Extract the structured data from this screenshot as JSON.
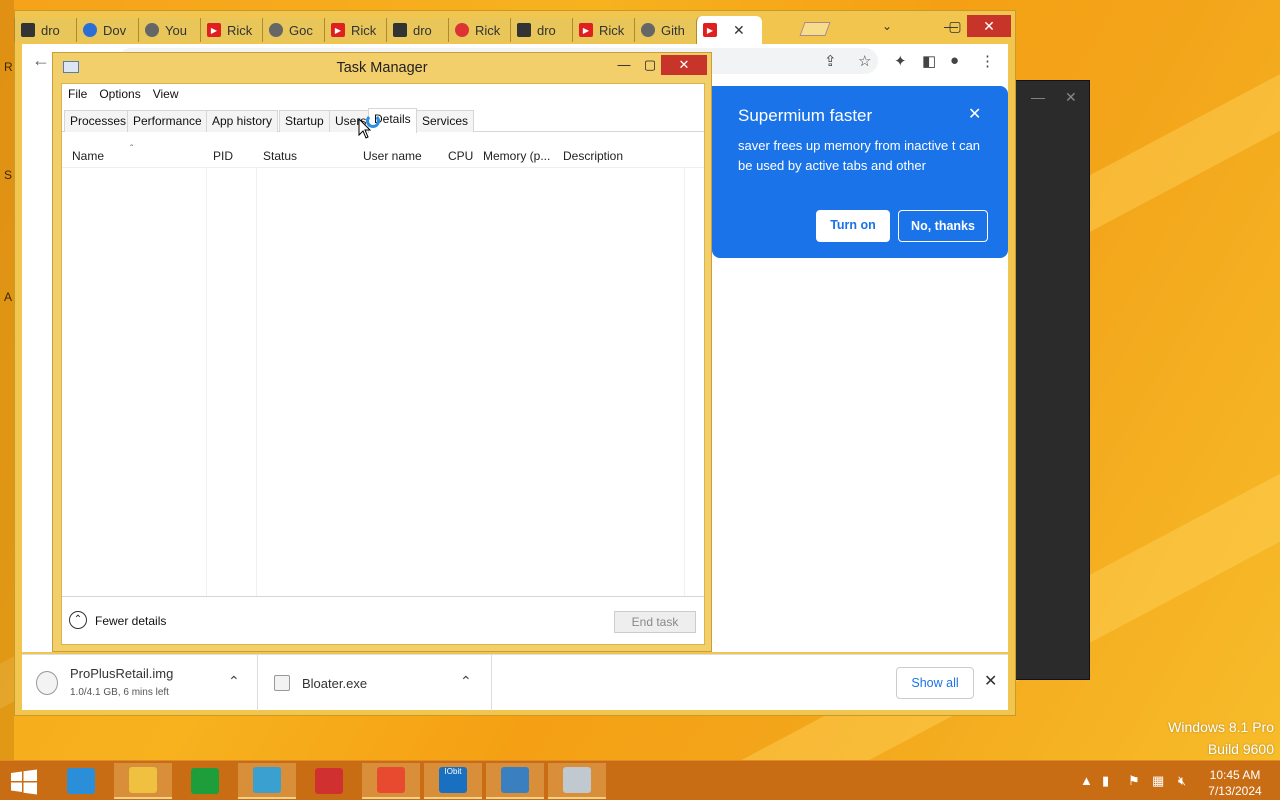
{
  "desktop": {
    "edge_letters": [
      "R",
      "S",
      "A"
    ],
    "os_name": "Windows 8.1 Pro",
    "build": "Build 9600"
  },
  "browser": {
    "tabs": [
      {
        "label": "dro",
        "icon": "terminal-icon"
      },
      {
        "label": "Dov",
        "icon": "power-icon"
      },
      {
        "label": "You",
        "icon": "supermium-icon"
      },
      {
        "label": "Rick",
        "icon": "youtube-icon"
      },
      {
        "label": "Goc",
        "icon": "supermium-icon"
      },
      {
        "label": "Rick",
        "icon": "youtube-icon"
      },
      {
        "label": "dro",
        "icon": "terminal-icon"
      },
      {
        "label": "Rick",
        "icon": "opera-icon"
      },
      {
        "label": "dro",
        "icon": "terminal-icon"
      },
      {
        "label": "Rick",
        "icon": "youtube-icon"
      },
      {
        "label": "Gith",
        "icon": "github-icon"
      },
      {
        "label": "",
        "icon": "youtube-icon",
        "active": true
      }
    ],
    "tab_close": "✕",
    "win_min": "—",
    "win_max": "▢",
    "win_close": "✕",
    "tab_search": "⌄",
    "memory_saver": {
      "title": "Supermium faster",
      "body": "saver frees up memory from inactive t can be used by active tabs and other",
      "close": "✕",
      "turn_on": "Turn on",
      "no_thanks": "No, thanks",
      "color": "#1a73e8"
    },
    "downloads": [
      {
        "name": "ProPlusRetail.img",
        "status": "1.0/4.1 GB, 6 mins left"
      },
      {
        "name": "Bloater.exe",
        "status": ""
      }
    ],
    "show_all": "Show all",
    "shelf_close": "✕"
  },
  "taskmgr": {
    "title": "Task Manager",
    "menu": [
      "File",
      "Options",
      "View"
    ],
    "tabs": [
      "Processes",
      "Performance",
      "App history",
      "Startup",
      "Users",
      "Details",
      "Services"
    ],
    "selected_tab": "Details",
    "columns": [
      "Name",
      "PID",
      "Status",
      "User name",
      "CPU",
      "Memory (p...",
      "Description"
    ],
    "fewer_details": "Fewer details",
    "end_task": "End task",
    "min": "—",
    "max": "▢",
    "close": "✕"
  },
  "taskbar": {
    "apps": [
      {
        "name": "internet-explorer-icon",
        "running": false
      },
      {
        "name": "file-explorer-icon",
        "running": true
      },
      {
        "name": "store-icon",
        "running": false
      },
      {
        "name": "chrome-like-icon",
        "running": true
      },
      {
        "name": "monitor-app-icon",
        "running": false
      },
      {
        "name": "media-player-icon",
        "running": true
      },
      {
        "name": "iobit-icon",
        "running": true
      },
      {
        "name": "network-app-icon",
        "running": true
      },
      {
        "name": "task-manager-icon",
        "running": true
      }
    ],
    "iobit_label": "IObit",
    "time": "10:45 AM",
    "date": "7/13/2024"
  }
}
